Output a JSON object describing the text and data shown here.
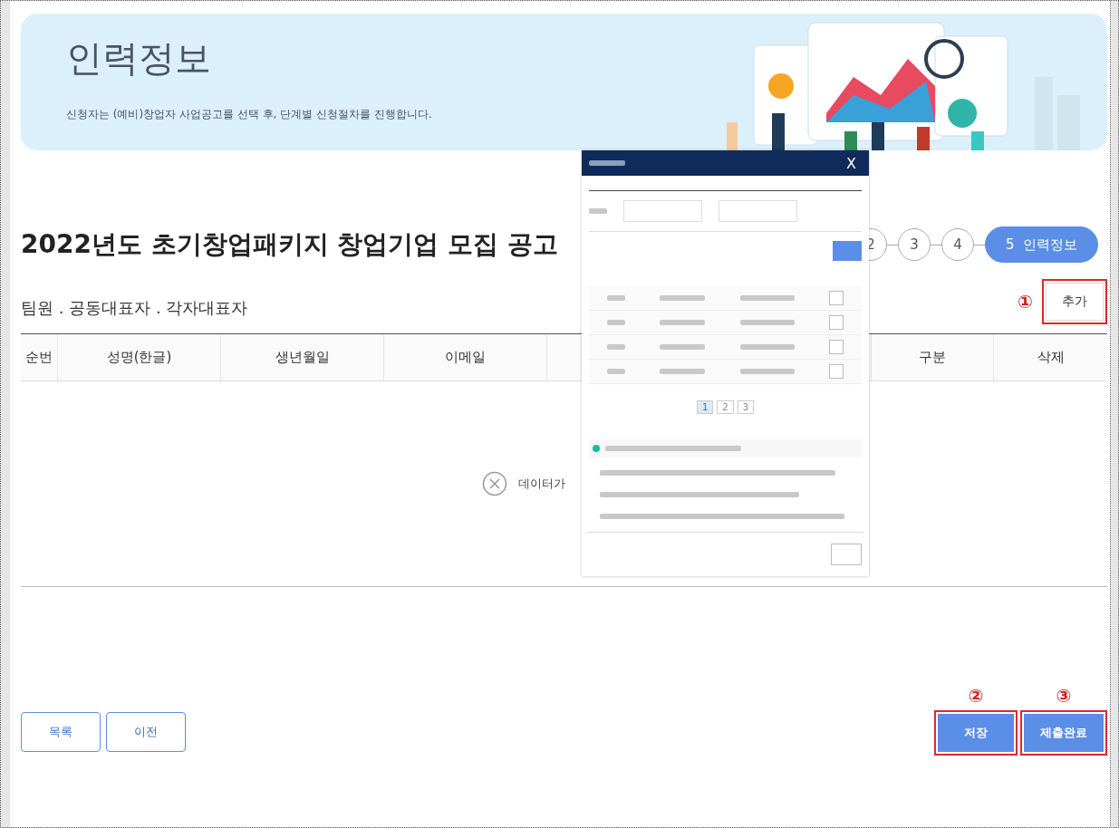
{
  "header": {
    "title": "인력정보",
    "subtitle": "신청자는 (예비)창업자 사업공고를 선택 후, 단계별 신청절차를 진행합니다."
  },
  "announcement_title": "2022년도 초기창업패키지 창업기업 모집 공고",
  "steps": [
    {
      "number": "2",
      "selected": false
    },
    {
      "number": "3",
      "selected": false
    },
    {
      "number": "4",
      "selected": false
    },
    {
      "number": "5",
      "label": "인력정보",
      "selected": true
    }
  ],
  "section_title": "팀원 . 공동대표자 . 각자대표자",
  "add_button": {
    "label": "추가",
    "marker": "①"
  },
  "table": {
    "columns": [
      "순번",
      "성명(한글)",
      "생년월일",
      "이메일",
      "구분",
      "삭제"
    ],
    "empty_message": "데이터가"
  },
  "buttons_left": [
    "목록",
    "이전"
  ],
  "buttons_right": [
    {
      "label": "저장",
      "marker": "②"
    },
    {
      "label": "제출완료",
      "marker": "③"
    }
  ],
  "popup": {
    "close": "X",
    "pages": [
      "1",
      "2",
      "3"
    ]
  }
}
